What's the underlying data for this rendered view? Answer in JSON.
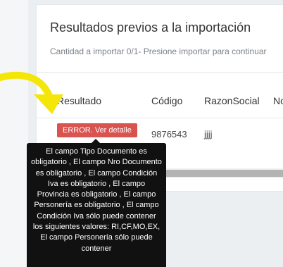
{
  "card": {
    "title": "Resultados previos a la importación",
    "subtitle": "Cantidad a importar 0/1- Presione importar para continuar"
  },
  "table": {
    "headers": [
      "Resultado",
      "Código",
      "RazonSocial",
      "No"
    ],
    "rows": [
      {
        "result_label": "ERROR. Ver detalle",
        "codigo": "9876543",
        "razon_social": "jjjj"
      }
    ]
  },
  "tooltip": {
    "text": "El campo Tipo Documento es obligatorio , El campo Nro Documento es obligatorio , El campo Condición Iva es obligatorio , El campo Provincia es obligatorio , El campo Personería es obligatorio , El campo Condición Iva sólo puede contener los siguientes valores: RI,CF,MO,EX, El campo Personería sólo puede contener"
  },
  "colors": {
    "error_badge": "#d9534f",
    "tooltip_bg": "#111111",
    "annotation_arrow": "#f5e60a"
  },
  "icons": {
    "annotation": "yellow-arrow-icon"
  }
}
